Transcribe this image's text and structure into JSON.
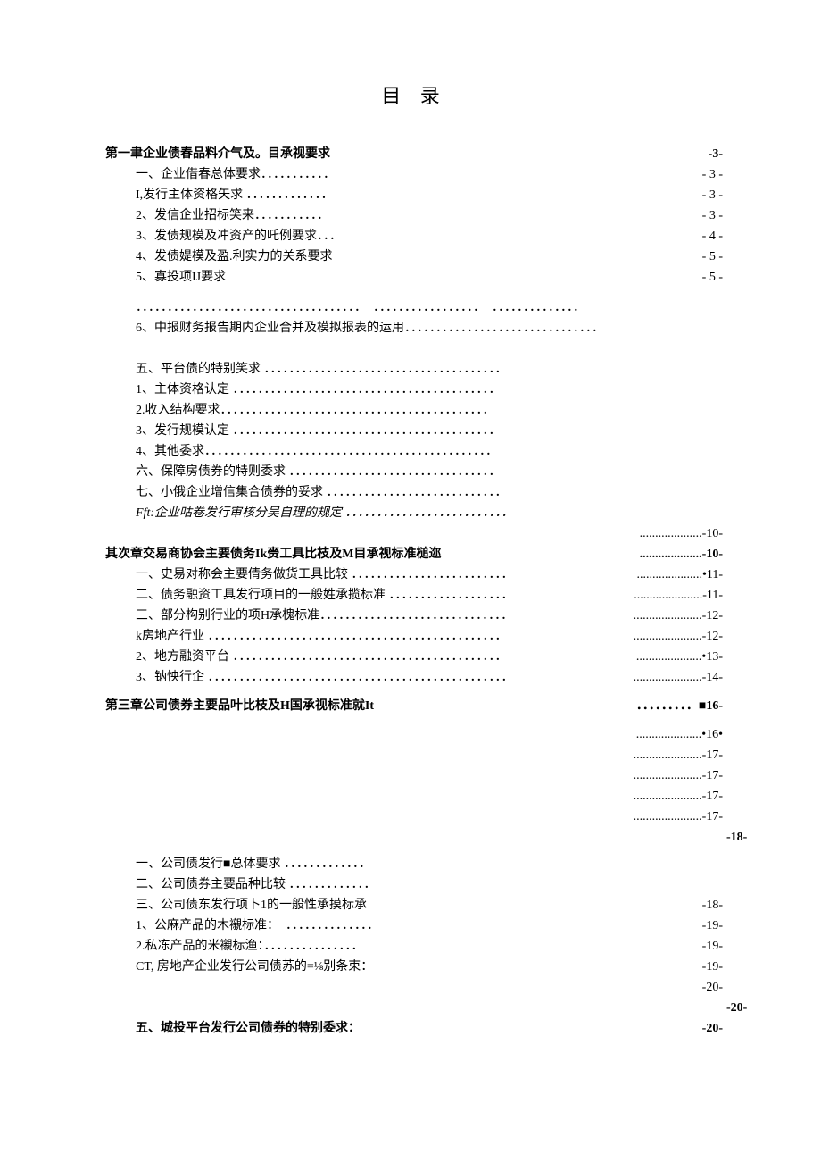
{
  "title": "目 录",
  "lines": [
    {
      "indent": 0,
      "label": "第一聿企业债春品料介气及。目承视要求",
      "leader": "bold-dots",
      "page": "-3-",
      "bold": true
    },
    {
      "indent": 1,
      "label": "一、企业借春总体要求．．．．．．．．．．．",
      "leader": "dots",
      "page": "- 3 -",
      "bold": false
    },
    {
      "indent": 1,
      "label": "I,发行主体资格矢求 ．．．．．．．．．．．．．",
      "leader": "dots",
      "page": "- 3 -",
      "bold": false
    },
    {
      "indent": 1,
      "label": "2、发信企业招标笑来．．．．．．．．．．．",
      "leader": "dots",
      "page": "- 3 -",
      "bold": false
    },
    {
      "indent": 1,
      "label": "3、发债规模及冲资产的吒例要求．．．",
      "leader": "dots",
      "page": "- 4 -",
      "bold": false
    },
    {
      "indent": 1,
      "label": "4、发债媞模及盈.利实力的关系要求",
      "leader": "dots",
      "page": "- 5 -",
      "bold": false
    },
    {
      "indent": 1,
      "label": "5、寡投项IJ要求",
      "leader": "dots",
      "page": "- 5 -",
      "bold": false
    },
    {
      "spacer": true,
      "height": 10
    },
    {
      "indent": 1,
      "label": "．．．．．．．．．．．．．．．．．．．．．．．．．．．．．．．．．．．．　．．．．．．．．．．．．．．．．．　．．．．．．．．．．．．．．",
      "leader": "",
      "page": "",
      "bold": false
    },
    {
      "indent": 1,
      "label": "6、中报财务报告期内企业合并及模拟报表的运用．．．．．．．．．．．．．．．．．．．．．．．．．．．．．．．",
      "leader": "",
      "page": "",
      "bold": false
    },
    {
      "spacer": true,
      "height": 22
    },
    {
      "indent": 1,
      "label": "五、平台债的特别笑求 ．．．．．．．．．．．．．．．．．．．．．．．．．．．．．．．．．．．．．．",
      "leader": "",
      "page": "",
      "bold": false
    },
    {
      "indent": 1,
      "label": "1、主体资格认定 ．．．．．．．．．．．．．．．．．．．．．．．．．．．．．．．．．．．．．．．．．．",
      "leader": "",
      "page": "",
      "bold": false
    },
    {
      "indent": 1,
      "label": "2.收入结构要求．．．．．．．．．．．．．．．．．．．．．．．．．．．．．．．．．．．．．．．．．．．",
      "leader": "",
      "page": "",
      "bold": false
    },
    {
      "indent": 1,
      "label": "3、发行规模认定 ．．．．．．．．．．．．．．．．．．．．．．．．．．．．．．．．．．．．．．．．．．",
      "leader": "",
      "page": "",
      "bold": false
    },
    {
      "indent": 1,
      "label": "4、其他委求．．．．．．．．．．．．．．．．．．．．．．．．．．．．．．．．．．．．．．．．．．．．．．",
      "leader": "",
      "page": "",
      "bold": false
    },
    {
      "indent": 1,
      "label": "六、保障房债券的特则委求 ．．．．．．．．．．．．．．．．．．．．．．．．．．．．．．．．．",
      "leader": "",
      "page": "",
      "bold": false
    },
    {
      "indent": 1,
      "label": "七、小俄企业增信集合债券的妥求 ．．．．．．．．．．．．．．．．．．．．．．．．．．．．",
      "leader": "",
      "page": "",
      "bold": false
    },
    {
      "indent": 1,
      "label": "Fft:企业咕卷发行审核分吴自理的规定 ．．．．．．．．．．．．．．．．．．．．．．．．．．",
      "leader": "",
      "page": "",
      "bold": false,
      "italic": true
    },
    {
      "indent": 0,
      "label": "",
      "leader": "",
      "page": "....................-10-",
      "bold": false
    },
    {
      "indent": 0,
      "label": "其次章交易商协会主要债务Ik赍工具比枝及M目承视标准槌迩",
      "leader": "",
      "page": "....................-10-",
      "bold": true
    },
    {
      "indent": 1,
      "label": "一、史易对称会主要倩务做货工具比较 ．．．．．．．．．．．．．．．．．．．．．．．．．",
      "leader": "",
      "page": ".....................•11-",
      "bold": false
    },
    {
      "indent": 1,
      "label": "二、债务融资工具发行项目的一般姓承揽标准 ．．．．．．．．．．．．．．．．．．．",
      "leader": "",
      "page": "......................-11-",
      "bold": false
    },
    {
      "indent": 1,
      "label": "三、部分构别行业的项H承槐标准．．．．．．．．．．．．．．．．．．．．．．．．．．．．．．",
      "leader": "",
      "page": "......................-12-",
      "bold": false
    },
    {
      "indent": 1,
      "label": "k房地产行业 ．．．．．．．．．．．．．．．．．．．．．．．．．．．．．．．．．．．．．．．．．．．．．．．",
      "leader": "",
      "page": "......................-12-",
      "bold": false
    },
    {
      "indent": 1,
      "label": "2、地方融资平台 ．．．．．．．．．．．．．．．．．．．．．．．．．．．．．．．．．．．．．．．．．．．",
      "leader": "",
      "page": ".....................•13-",
      "bold": false
    },
    {
      "indent": 1,
      "label": "3、钠怏行企 ．．．．．．．．．．．．．．．．．．．．．．．．．．．．．．．．．．．．．．．．．．．．．．．．",
      "leader": "",
      "page": "......................-14-",
      "bold": false
    },
    {
      "spacer": true,
      "height": 8
    },
    {
      "indent": 0,
      "label": "第三章公司债券主要品叶比枝及H国承视标准就It",
      "leader": "",
      "page": "．．．．．．．．．■16-",
      "bold": true
    },
    {
      "spacer": true,
      "height": 8
    },
    {
      "indent": 0,
      "label": "",
      "leader": "",
      "page": ".....................•16•",
      "bold": false
    },
    {
      "indent": 0,
      "label": "",
      "leader": "",
      "page": "......................-17-",
      "bold": false
    },
    {
      "indent": 0,
      "label": "",
      "leader": "",
      "page": "......................-17-",
      "bold": false
    },
    {
      "indent": 0,
      "label": "",
      "leader": "",
      "page": "......................-17-",
      "bold": false
    },
    {
      "indent": 0,
      "label": "",
      "leader": "",
      "page": "......................-17-",
      "bold": false
    },
    {
      "indent": 0,
      "label": "",
      "leader": "bold-dots",
      "page": "-18-",
      "bold": true,
      "fullwidth": true
    },
    {
      "spacer": true,
      "height": 6
    },
    {
      "indent": 1,
      "label": "一、公司债发行■总体要求 ．．．．．．．．．．．．．",
      "leader": "",
      "page": "",
      "bold": false
    },
    {
      "indent": 1,
      "label": "二、公司债券主要品种比较 ．．．．．．．．．．．．．",
      "leader": "",
      "page": "",
      "bold": false
    },
    {
      "indent": 1,
      "label": "三、公司债东发行项卜1的一般性承摸标承",
      "leader": "",
      "page": "-18-",
      "bold": false
    },
    {
      "indent": 1,
      "label": "1、公麻产品的木襯标准：　．．．．．．．．．．．．．．",
      "leader": "",
      "page": "-19-",
      "bold": false
    },
    {
      "indent": 1,
      "label": "2.私冻产品的米襯标渔：．．．．．．．．．．．．．．．",
      "leader": "",
      "page": "-19-",
      "bold": false
    },
    {
      "indent": 1,
      "label": "CT, 房地产企业发行公司债苏的=⅛别条束：",
      "leader": "",
      "page": "-19-",
      "bold": false
    },
    {
      "indent": 1,
      "label": "",
      "leader": "",
      "page": "-20-",
      "bold": false
    },
    {
      "indent": 0,
      "label": "",
      "leader": "dots",
      "page": "-20-",
      "bold": true,
      "fullwidth": true
    },
    {
      "indent": 1,
      "label": "五、城投平台发行公司债券的特别委求：",
      "leader": "dots",
      "page": "-20-",
      "bold": true
    }
  ]
}
